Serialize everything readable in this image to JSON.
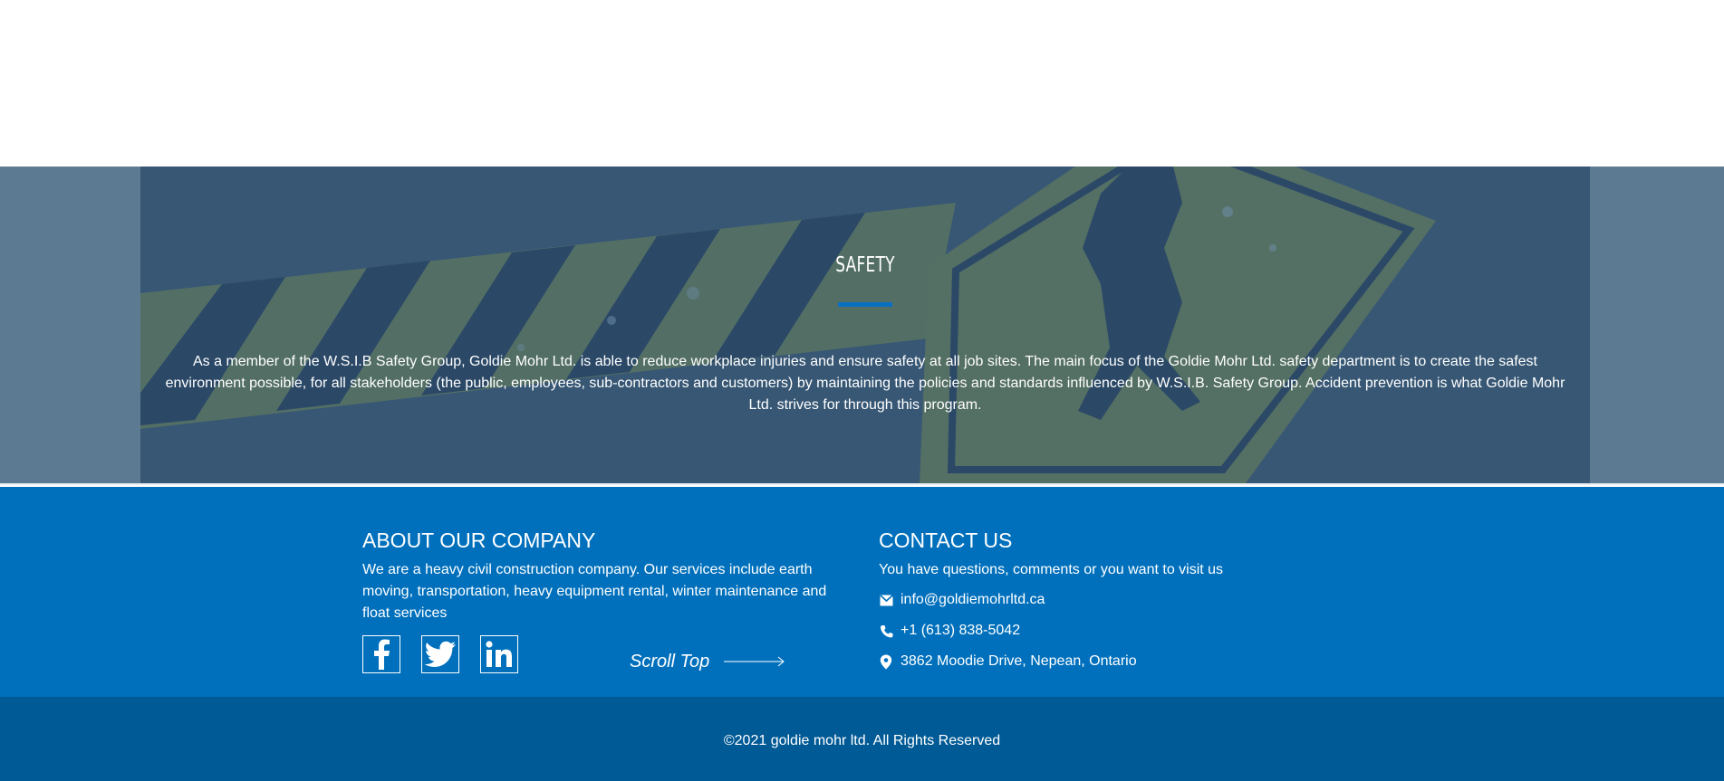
{
  "safety": {
    "title": "SAFETY",
    "text": "As a member of the W.S.I.B Safety Group, Goldie Mohr Ltd. is able to reduce workplace injuries and ensure safety at all job sites. The main focus of the Goldie Mohr Ltd. safety department is to create the safest environment possible, for all stakeholders (the public, employees, sub-contractors and customers) by maintaining the policies and standards influenced by W.S.I.B. Safety Group. Accident prevention is what Goldie Mohr Ltd. strives for through this program."
  },
  "about": {
    "heading": "ABOUT OUR COMPANY",
    "text": "We are a heavy civil construction company. Our services include earth moving, transportation, heavy equipment rental, winter maintenance and float services",
    "socials": [
      {
        "icon": "facebook-icon"
      },
      {
        "icon": "twitter-icon"
      },
      {
        "icon": "linkedin-icon"
      }
    ],
    "scroll_top": "Scroll Top"
  },
  "contact": {
    "heading": "CONTACT US",
    "intro": "You have questions, comments or you want to visit us",
    "email": "info@goldiemohrltd.ca",
    "phone": "+1 (613) 838-5042",
    "address": "3862 Moodie Drive, Nepean, Ontario"
  },
  "footer": {
    "copyright": "©2021 goldie mohr ltd. All Rights Reserved"
  },
  "colors": {
    "primary_blue": "#0070bc",
    "footer_dark_blue": "#005a95",
    "safety_overlay": "#3a5a78",
    "accent_olive": "#5f7a68"
  }
}
